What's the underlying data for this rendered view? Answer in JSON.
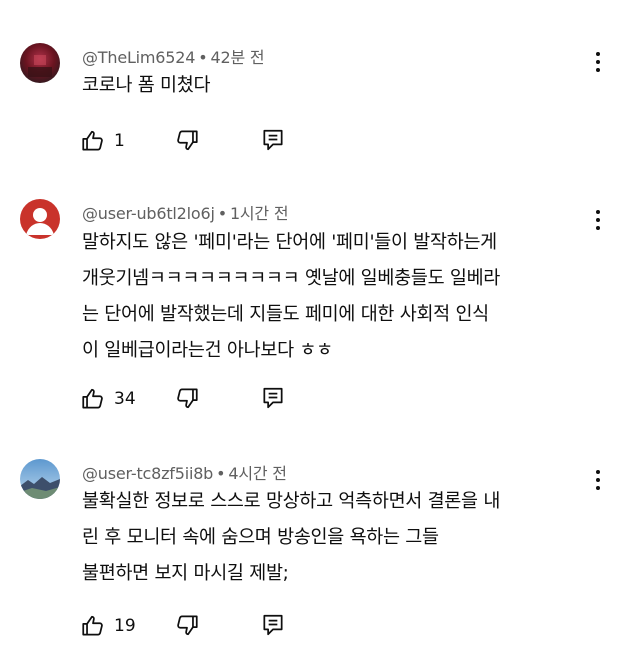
{
  "comments": [
    {
      "handle": "@TheLim6524",
      "time": "42분 전",
      "lines": [
        "코로나 폼 미쳤다"
      ],
      "likes": "1",
      "avatar": {
        "colors": [
          "#2b1a1f",
          "#6a1420",
          "#b0314a"
        ],
        "icon": "dark-red-photo-avatar"
      }
    },
    {
      "handle": "@user-ub6tl2lo6j",
      "time": "1시간 전",
      "lines": [
        "말하지도 않은 '페미'라는 단어에 '페미'들이 발작하는게",
        "개웃기넴ㅋㅋㅋㅋㅋㅋㅋㅋㅋ 옛날에 일베충들도 일베라",
        "는 단어에 발작했는데 지들도 페미에 대한 사회적 인식",
        "이 일베급이라는건 아나보다 ㅎㅎ"
      ],
      "likes": "34",
      "avatar": {
        "colors": [
          "#c9332b",
          "#ffffff"
        ],
        "icon": "default-person-avatar"
      }
    },
    {
      "handle": "@user-tc8zf5ii8b",
      "time": "4시간 전",
      "lines": [
        "불확실한 정보로 스스로 망상하고 억측하면서 결론을 내",
        "린 후 모니터 속에 숨으며 방송인을 욕하는 그들",
        "불편하면 보지 마시길 제발;"
      ],
      "likes": "19",
      "avatar": {
        "colors": [
          "#7fb3de",
          "#3d4f6b",
          "#9fc8a0"
        ],
        "icon": "landscape-photo-avatar"
      }
    }
  ],
  "icons": {
    "like": "thumbs-up-icon",
    "dislike": "thumbs-down-icon",
    "reply": "reply-icon",
    "more": "more-vert-icon"
  },
  "separator": "•"
}
